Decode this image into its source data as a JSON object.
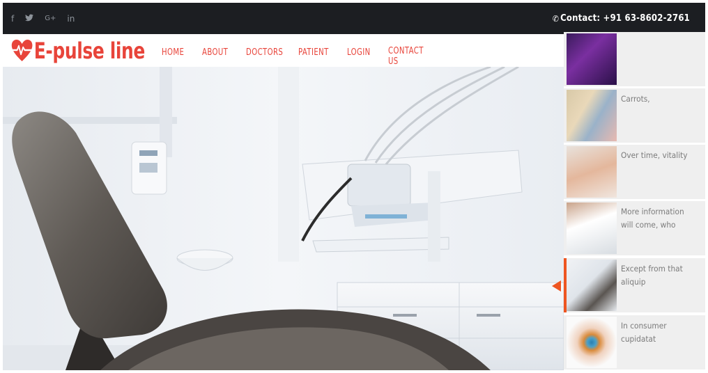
{
  "topbar": {
    "social": [
      {
        "icon": "facebook-icon",
        "glyph": "f"
      },
      {
        "icon": "twitter-icon",
        "glyph": "🐦"
      },
      {
        "icon": "google-plus-icon",
        "glyph": "G+"
      },
      {
        "icon": "linkedin-icon",
        "glyph": "in"
      }
    ],
    "contact_label": "Contact: +91 63-8602-2761"
  },
  "header": {
    "logo_text": "E-pulse line",
    "nav": [
      "HOME",
      "ABOUT",
      "DOCTORS",
      "PATIENT",
      "LOGIN",
      "CONTACT US"
    ]
  },
  "sidebar": {
    "items": [
      {
        "caption": ""
      },
      {
        "caption": "Carrots,"
      },
      {
        "caption": "Over time, vitality"
      },
      {
        "caption": "More information will come, who"
      },
      {
        "caption": "Except from that aliquip"
      },
      {
        "caption": "In consumer cupidatat"
      }
    ],
    "active_index": 4
  },
  "colors": {
    "topbar_bg": "#1c1e22",
    "brand_red": "#e8443a",
    "accent_orange": "#ee5521",
    "sidebar_bg": "#efefef"
  }
}
